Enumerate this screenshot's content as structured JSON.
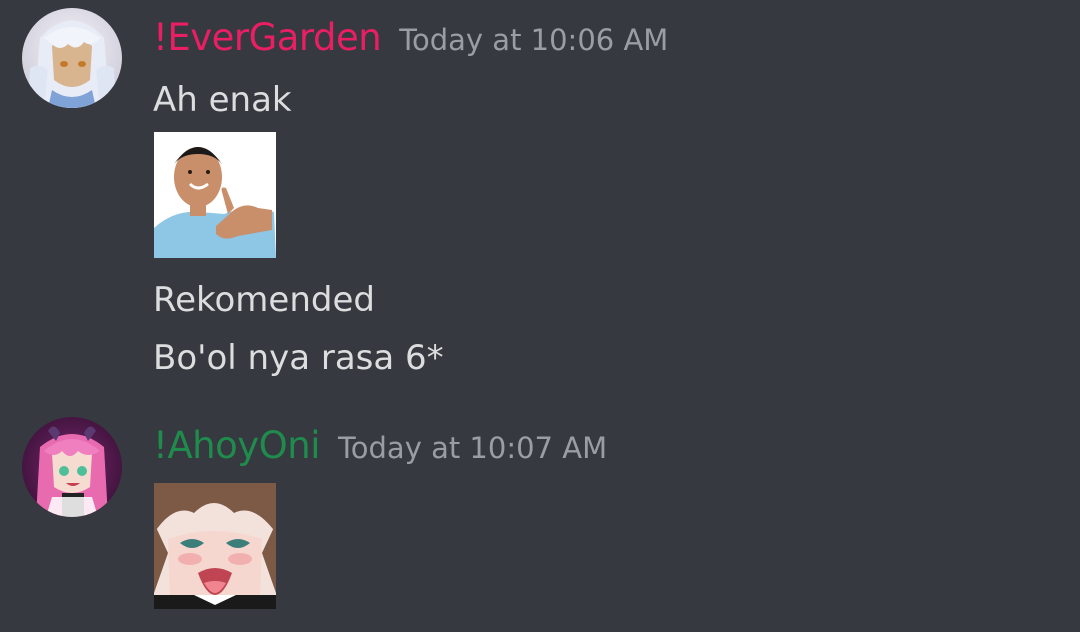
{
  "messages": [
    {
      "author": "!EverGarden",
      "author_color": "#e91e63",
      "timestamp": "Today at 10:06 AM",
      "lines": [
        "Ah enak",
        "Rekomended",
        "Bo'ol nya rasa 6*"
      ]
    },
    {
      "author": "!AhoyOni",
      "author_color": "#1f8b4c",
      "timestamp": "Today at 10:07 AM",
      "lines": []
    }
  ],
  "colors": {
    "background": "#36393f",
    "message_text": "#dcddde",
    "timestamp": "#9a9ea4"
  }
}
